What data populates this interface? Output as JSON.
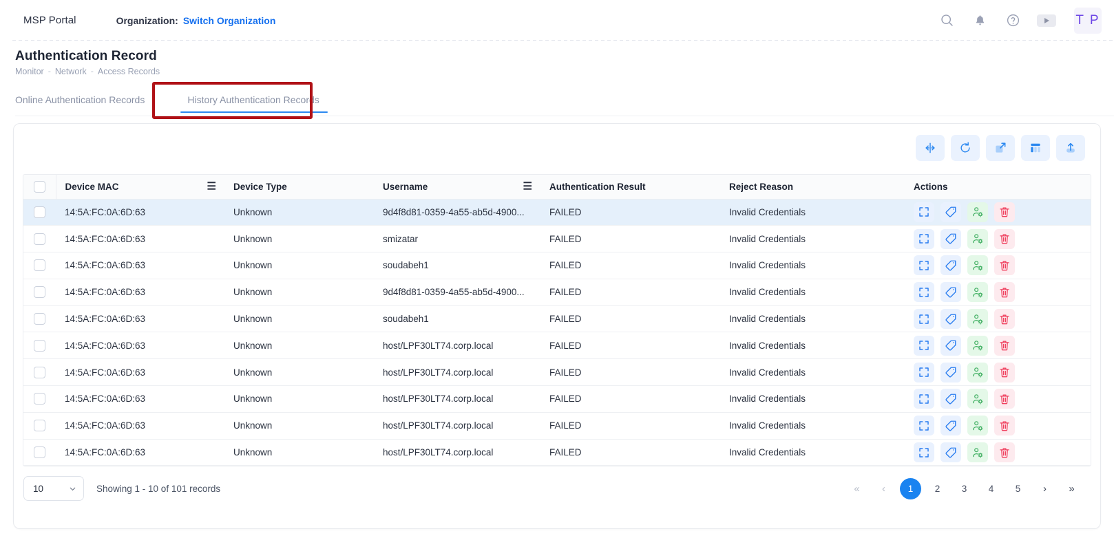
{
  "topbar": {
    "brand": "MSP Portal",
    "org_label": "Organization:",
    "org_link": "Switch Organization",
    "icons": [
      "search-icon",
      "bell-icon",
      "help-icon",
      "play-icon"
    ],
    "avatar_initials": "T P"
  },
  "page": {
    "title": "Authentication Record",
    "breadcrumb": [
      "Monitor",
      "Network",
      "Access Records"
    ],
    "breadcrumb_sep": "-"
  },
  "tabs": [
    {
      "label": "Online Authentication Records",
      "active": false
    },
    {
      "label": "History Authentication Records",
      "active": true
    }
  ],
  "toolbar": [
    {
      "name": "fit-columns-icon",
      "title": "Fit columns"
    },
    {
      "name": "refresh-icon",
      "title": "Refresh"
    },
    {
      "name": "expand-icon",
      "title": "Full screen"
    },
    {
      "name": "columns-icon",
      "title": "Column settings"
    },
    {
      "name": "export-icon",
      "title": "Export"
    }
  ],
  "table": {
    "columns": [
      {
        "key": "mac",
        "label": "Device MAC",
        "menu": true
      },
      {
        "key": "type",
        "label": "Device Type",
        "menu": false
      },
      {
        "key": "user",
        "label": "Username",
        "menu": true
      },
      {
        "key": "result",
        "label": "Authentication Result",
        "menu": false
      },
      {
        "key": "reason",
        "label": "Reject Reason",
        "menu": false
      },
      {
        "key": "actions",
        "label": "Actions",
        "menu": false
      }
    ],
    "rows": [
      {
        "mac": "14:5A:FC:0A:6D:63",
        "type": "Unknown",
        "user": "9d4f8d81-0359-4a55-ab5d-4900...",
        "result": "FAILED",
        "reason": "Invalid Credentials",
        "selected": true
      },
      {
        "mac": "14:5A:FC:0A:6D:63",
        "type": "Unknown",
        "user": "smizatar",
        "result": "FAILED",
        "reason": "Invalid Credentials",
        "selected": false
      },
      {
        "mac": "14:5A:FC:0A:6D:63",
        "type": "Unknown",
        "user": "soudabeh1",
        "result": "FAILED",
        "reason": "Invalid Credentials",
        "selected": false
      },
      {
        "mac": "14:5A:FC:0A:6D:63",
        "type": "Unknown",
        "user": "9d4f8d81-0359-4a55-ab5d-4900...",
        "result": "FAILED",
        "reason": "Invalid Credentials",
        "selected": false
      },
      {
        "mac": "14:5A:FC:0A:6D:63",
        "type": "Unknown",
        "user": "soudabeh1",
        "result": "FAILED",
        "reason": "Invalid Credentials",
        "selected": false
      },
      {
        "mac": "14:5A:FC:0A:6D:63",
        "type": "Unknown",
        "user": "host/LPF30LT74.corp.local",
        "result": "FAILED",
        "reason": "Invalid Credentials",
        "selected": false
      },
      {
        "mac": "14:5A:FC:0A:6D:63",
        "type": "Unknown",
        "user": "host/LPF30LT74.corp.local",
        "result": "FAILED",
        "reason": "Invalid Credentials",
        "selected": false
      },
      {
        "mac": "14:5A:FC:0A:6D:63",
        "type": "Unknown",
        "user": "host/LPF30LT74.corp.local",
        "result": "FAILED",
        "reason": "Invalid Credentials",
        "selected": false
      },
      {
        "mac": "14:5A:FC:0A:6D:63",
        "type": "Unknown",
        "user": "host/LPF30LT74.corp.local",
        "result": "FAILED",
        "reason": "Invalid Credentials",
        "selected": false
      },
      {
        "mac": "14:5A:FC:0A:6D:63",
        "type": "Unknown",
        "user": "host/LPF30LT74.corp.local",
        "result": "FAILED",
        "reason": "Invalid Credentials",
        "selected": false
      }
    ],
    "row_actions": [
      {
        "name": "details-icon",
        "style": "blue"
      },
      {
        "name": "tag-icon",
        "style": "blue"
      },
      {
        "name": "user-settings-icon",
        "style": "green"
      },
      {
        "name": "delete-icon",
        "style": "red"
      }
    ]
  },
  "pagination": {
    "page_size": "10",
    "showing": "Showing 1 - 10 of 101 records",
    "pages": [
      "1",
      "2",
      "3",
      "4",
      "5"
    ],
    "current_page": "1",
    "first_label": "«",
    "prev_label": "‹",
    "next_label": "›",
    "last_label": "»"
  },
  "colors": {
    "accent_blue": "#1a83f0",
    "link_blue": "#1570ef",
    "highlight_red": "#b01116",
    "selected_row": "#e5f0fb",
    "avatar_purple": "#6d46e6"
  }
}
